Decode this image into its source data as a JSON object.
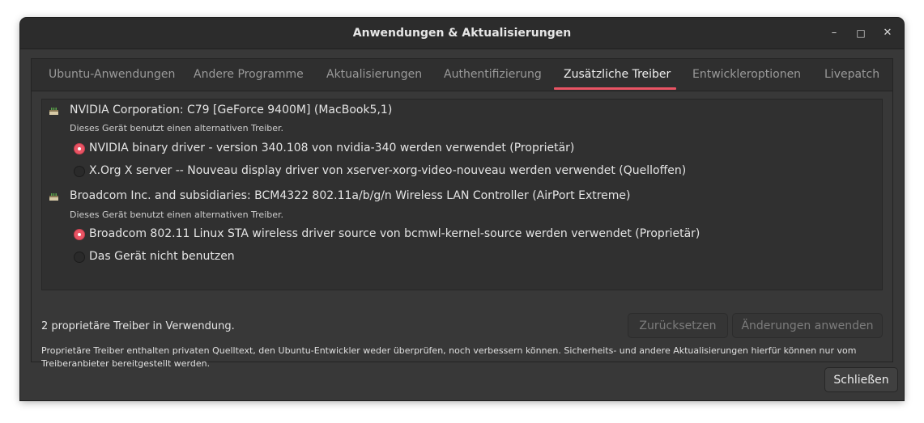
{
  "window": {
    "title": "Anwendungen & Aktualisierungen",
    "minimize_glyph": "–",
    "maximize_glyph": "□",
    "close_glyph": "✕"
  },
  "tabs": [
    {
      "label": "Ubuntu-Anwendungen",
      "active": false
    },
    {
      "label": "Andere Programme",
      "active": false
    },
    {
      "label": "Aktualisierungen",
      "active": false
    },
    {
      "label": "Authentifizierung",
      "active": false
    },
    {
      "label": "Zusätzliche Treiber",
      "active": true
    },
    {
      "label": "Entwickleroptionen",
      "active": false
    },
    {
      "label": "Livepatch",
      "active": false
    }
  ],
  "devices": [
    {
      "icon": "chip-icon",
      "name": "NVIDIA Corporation: C79 [GeForce 9400M] (MacBook5,1)",
      "subtitle": "Dieses Gerät benutzt einen alternativen Treiber.",
      "options": [
        {
          "label": "NVIDIA binary driver - version 340.108 von nvidia-340 werden verwendet (Proprietär)",
          "selected": true
        },
        {
          "label": "X.Org X server -- Nouveau display driver von xserver-xorg-video-nouveau werden verwendet (Quelloffen)",
          "selected": false
        }
      ]
    },
    {
      "icon": "chip-icon",
      "name": "Broadcom Inc. and subsidiaries: BCM4322 802.11a/b/g/n Wireless LAN Controller (AirPort Extreme)",
      "subtitle": "Dieses Gerät benutzt einen alternativen Treiber.",
      "options": [
        {
          "label": "Broadcom 802.11 Linux STA wireless driver source von bcmwl-kernel-source werden verwendet (Proprietär)",
          "selected": true
        },
        {
          "label": "Das Gerät nicht benutzen",
          "selected": false
        }
      ]
    }
  ],
  "status": "2 proprietäre Treiber in Verwendung.",
  "buttons": {
    "revert": "Zurücksetzen",
    "apply": "Änderungen anwenden",
    "close": "Schließen"
  },
  "note": "Proprietäre Treiber enthalten privaten Quelltext, den Ubuntu-Entwickler weder überprüfen, noch verbessern können. Sicherheits- und andere Aktualisierungen hierfür können nur vom Treiberanbieter bereitgestellt werden.",
  "colors": {
    "accent": "#e95464",
    "window_bg": "#383838",
    "titlebar_bg": "#2c2c2c",
    "list_bg": "#303030"
  }
}
